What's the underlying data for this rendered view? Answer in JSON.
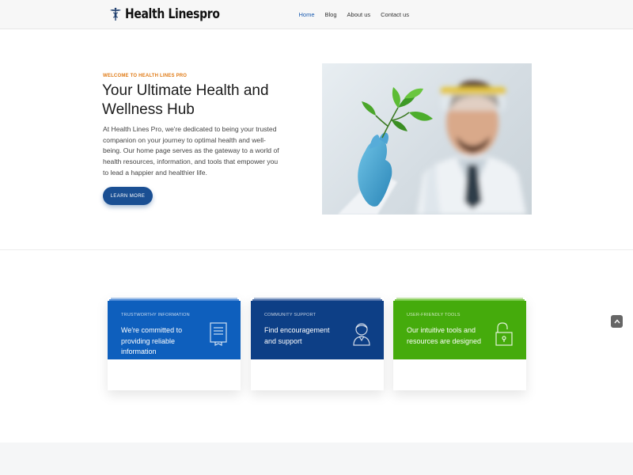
{
  "header": {
    "logo_text": "Health Linespro",
    "nav": [
      "Home",
      "Blog",
      "About us",
      "Contact us"
    ],
    "active_nav": "Home"
  },
  "hero": {
    "eyebrow": "WELCOME TO HEALTH LINES PRO",
    "title": "Your Ultimate Health and Wellness Hub",
    "body": "At Health Lines Pro, we're dedicated to being your trusted companion on your journey to optimal health and well-being. Our home page serves as the gateway to a world of health resources, information, and tools that empower you to lead a happier and healthier life.",
    "cta_label": "LEARN MORE",
    "image": "scientist-holding-plant-sprout-photo"
  },
  "features": [
    {
      "eyebrow": "TRUSTWORTHY INFORMATION",
      "text": "We're committed to providing reliable information",
      "icon": "document-icon",
      "color": "#0e5fbd"
    },
    {
      "eyebrow": "COMMUNITY SUPPORT",
      "text": "Find encouragement and support",
      "icon": "person-icon",
      "color": "#0d3f86"
    },
    {
      "eyebrow": "USER-FRIENDLY TOOLS",
      "text": "Our intuitive tools and resources are designed",
      "icon": "unlock-icon",
      "color": "#45ab0c"
    }
  ],
  "scroll_top": {
    "icon": "chevron-up-icon"
  },
  "colors": {
    "accent": "#1a4f93",
    "eyebrow": "#e07b16",
    "nav_active": "#1a5bb0"
  }
}
